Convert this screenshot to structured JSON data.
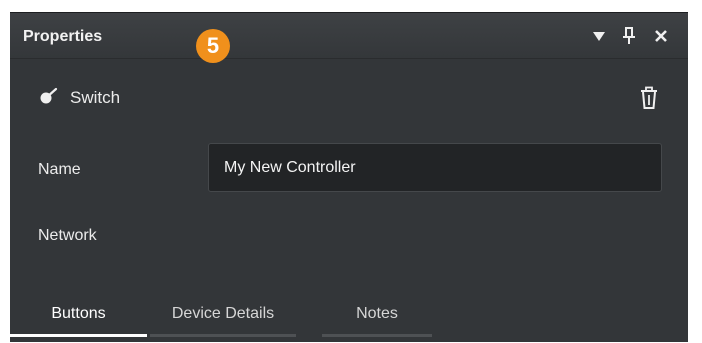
{
  "panel": {
    "title": "Properties",
    "icons": {
      "menu": "dropdown-triangle-icon",
      "pin": "pin-icon",
      "close": "close-icon"
    }
  },
  "badge": {
    "number": "5",
    "color": "#f0901c"
  },
  "device": {
    "icon": "switch-toggle-icon",
    "label": "Switch",
    "delete_icon": "trash-icon"
  },
  "fields": {
    "name_label": "Name",
    "name_value": "My New Controller",
    "network_label": "Network"
  },
  "tabs": [
    {
      "label": "Buttons",
      "active": true
    },
    {
      "label": "Device Details",
      "active": false
    },
    {
      "label": "Notes",
      "active": false
    }
  ]
}
